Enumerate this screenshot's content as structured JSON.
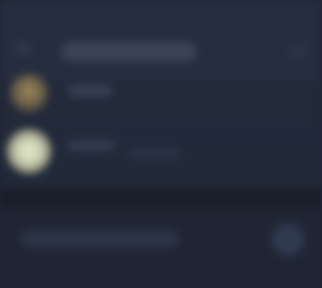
{
  "header": {
    "title": "",
    "back_icon": "back-arrow-icon",
    "more_icon": "more-options-icon"
  },
  "list": {
    "items": [
      {
        "name": "",
        "meta": ""
      },
      {
        "name": "",
        "meta": ""
      }
    ]
  },
  "footer": {
    "label": "",
    "action_icon": "action-icon"
  },
  "colors": {
    "background": "#222939",
    "header": "#262d3e",
    "divider": "#191e29",
    "footer": "#1f2533"
  }
}
